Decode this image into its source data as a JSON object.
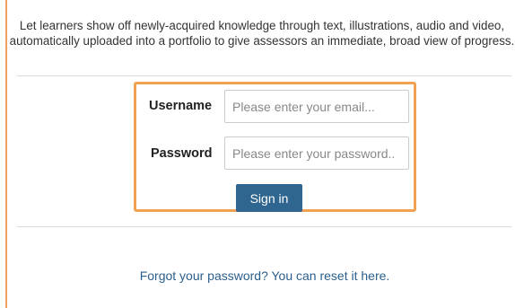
{
  "intro": {
    "text": "Let learners show off newly-acquired knowledge through text, illustrations, audio and video, automatically uploaded into a portfolio to give assessors an immediate, broad view of progress."
  },
  "login": {
    "username_label": "Username",
    "username_placeholder": "Please enter your email...",
    "username_value": "",
    "password_label": "Password",
    "password_placeholder": "Please enter your password..",
    "password_value": "",
    "signin_label": "Sign in"
  },
  "footer": {
    "forgot_text": "Forgot your password? You can reset it here."
  },
  "colors": {
    "highlight_border": "#f0a152",
    "button_bg": "#2f6690",
    "link": "#2a5e8c"
  }
}
